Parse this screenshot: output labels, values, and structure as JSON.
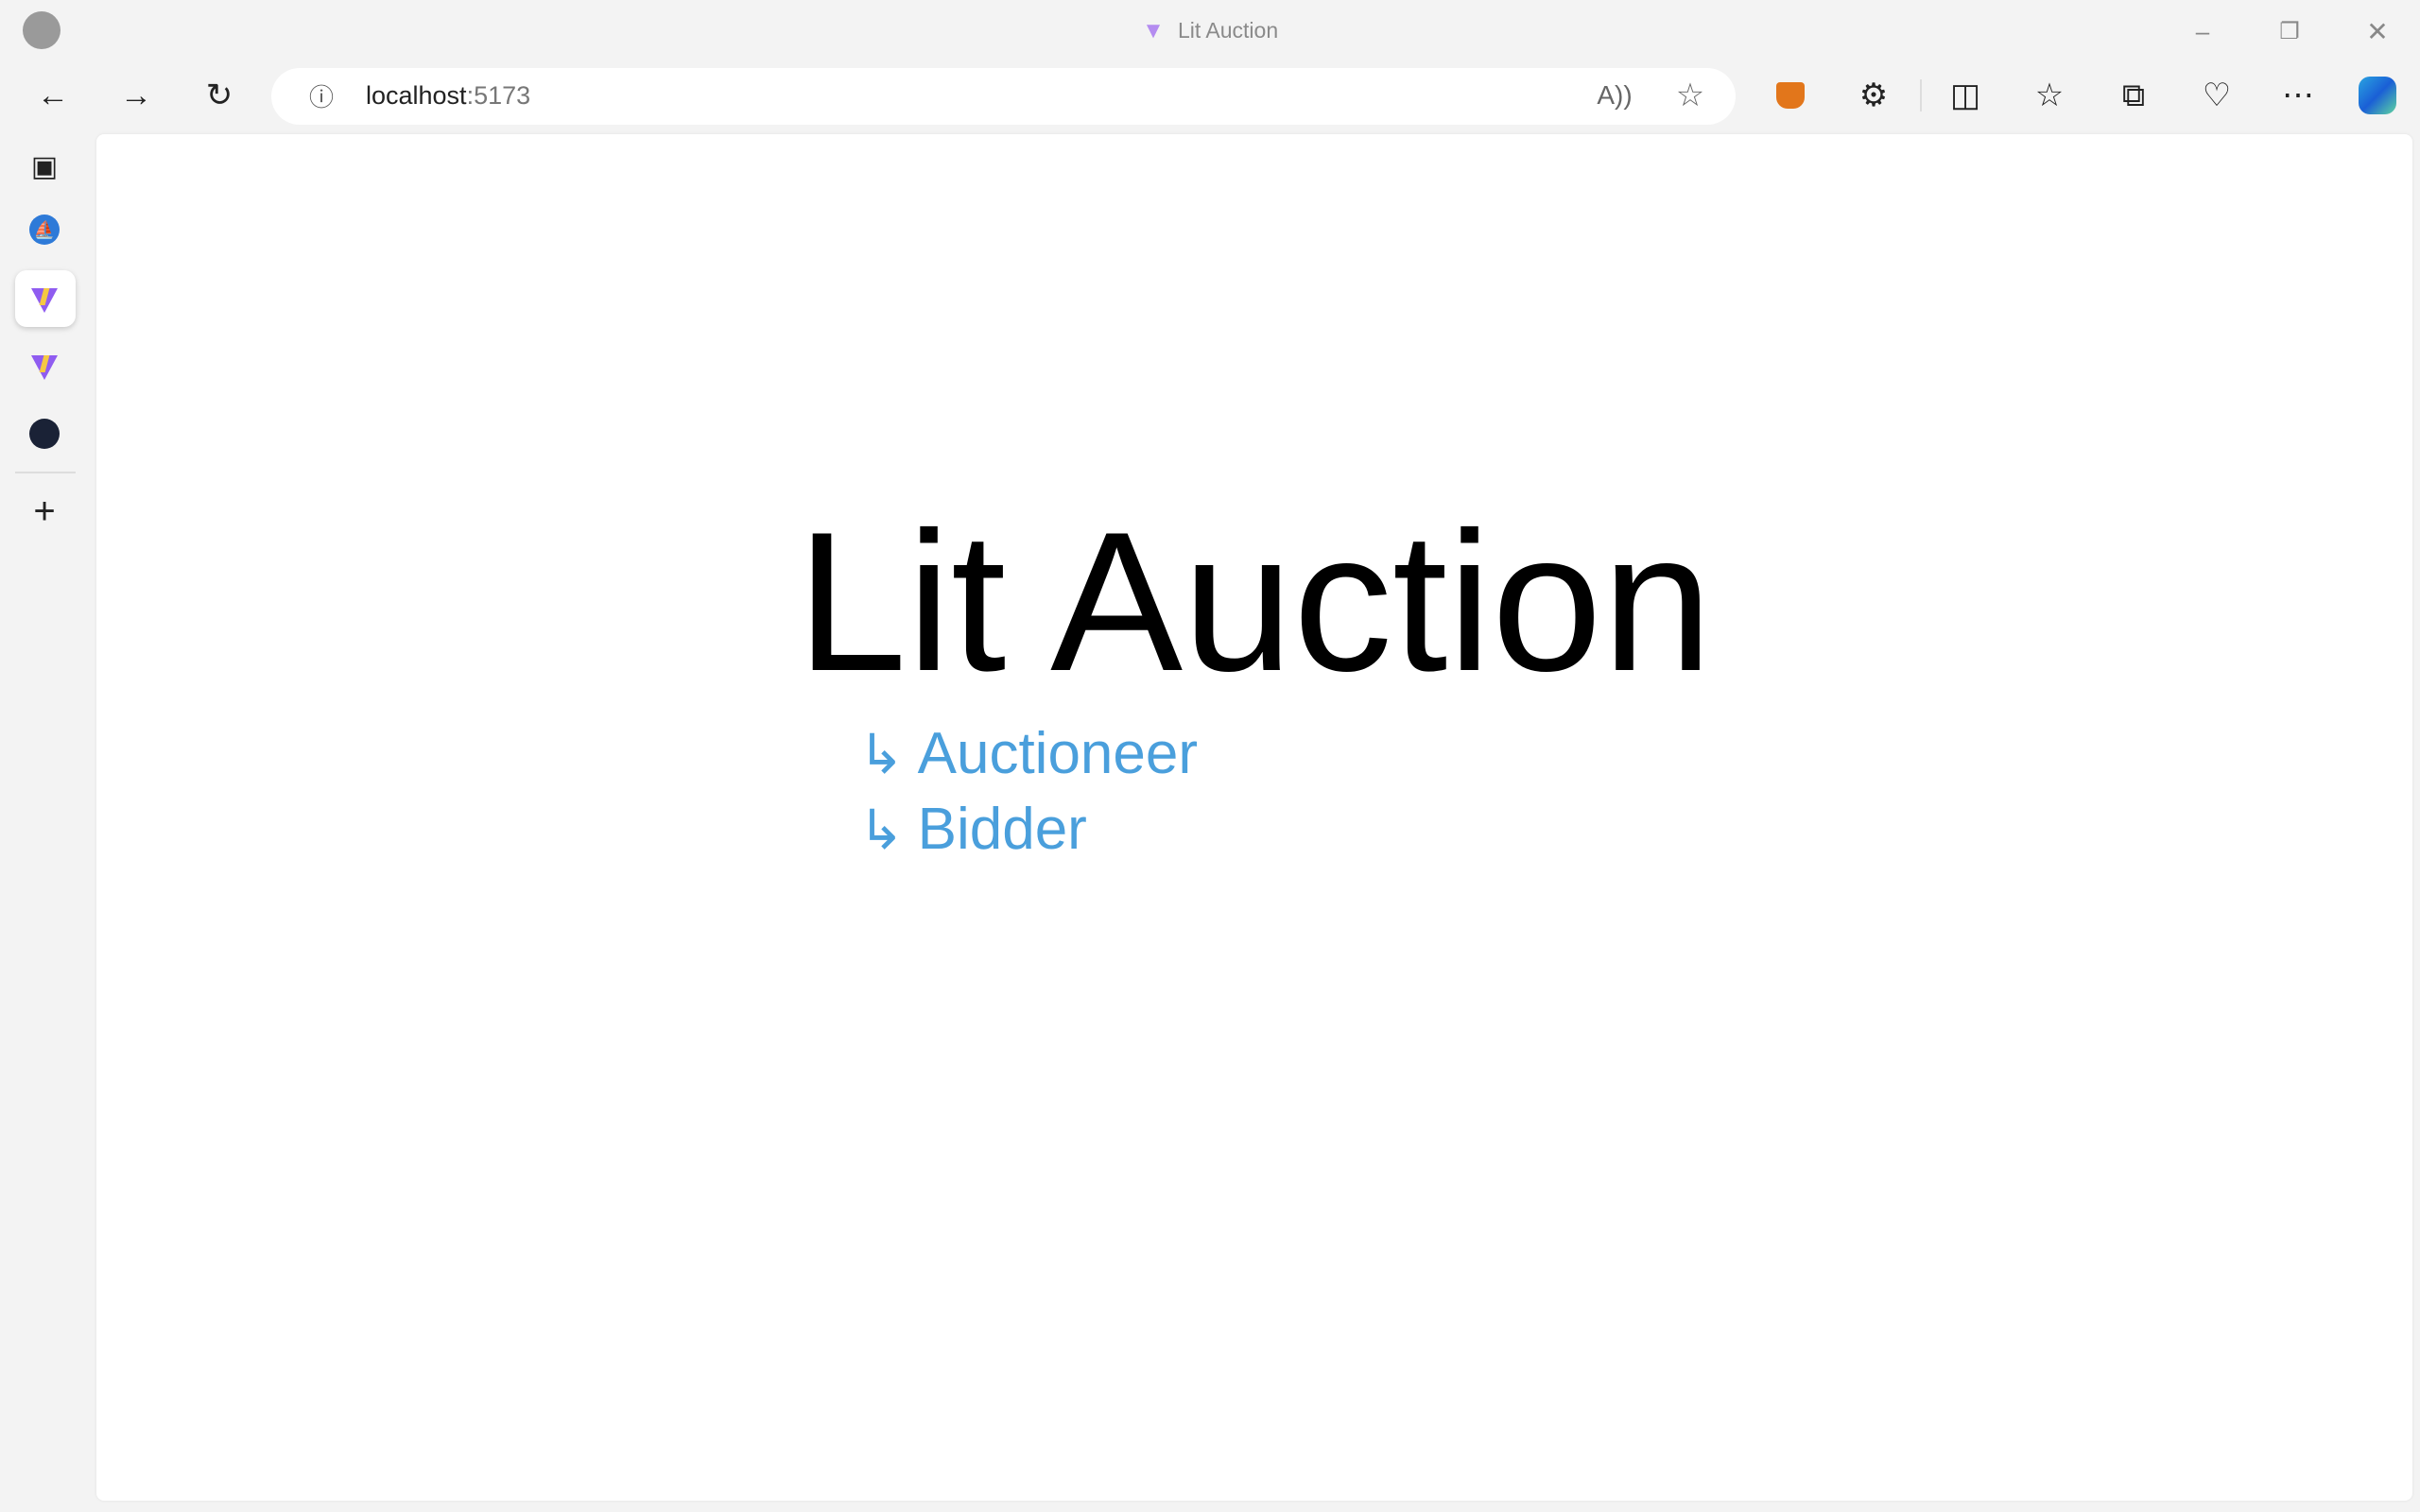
{
  "window": {
    "title": "Lit Auction"
  },
  "toolbar": {
    "url_host": "localhost",
    "url_port": ":5173"
  },
  "sidebar": {
    "items": [
      {
        "name": "tab-actions",
        "icon": "tab-actions-icon"
      },
      {
        "name": "opensea",
        "icon": "opensea-icon"
      },
      {
        "name": "vite-app-active",
        "icon": "vite-icon"
      },
      {
        "name": "vite-app",
        "icon": "vite-icon"
      },
      {
        "name": "coinmarketcap",
        "icon": "coinmarketcap-icon"
      }
    ]
  },
  "page": {
    "heading": "Lit Auction",
    "links": [
      {
        "arrow": "↳",
        "label": "Auctioneer"
      },
      {
        "arrow": "↳",
        "label": "Bidder"
      }
    ],
    "link_color": "#4a9fdc"
  }
}
